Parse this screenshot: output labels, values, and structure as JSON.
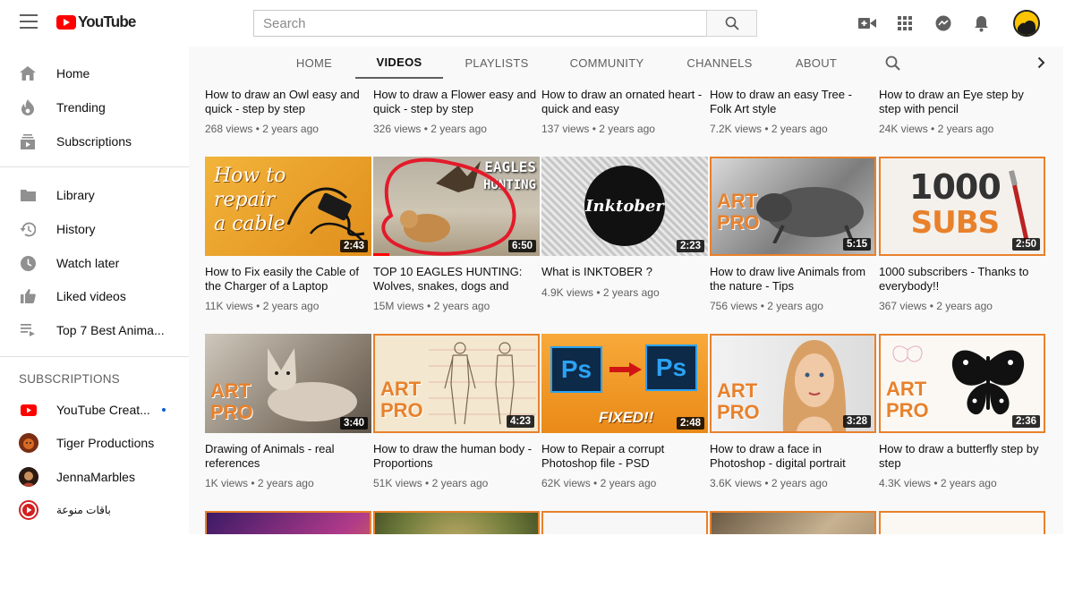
{
  "header": {
    "logo_text": "YouTube",
    "search_placeholder": "Search"
  },
  "sidebar": {
    "main_items": [
      {
        "label": "Home",
        "icon": "home-icon"
      },
      {
        "label": "Trending",
        "icon": "flame-icon"
      },
      {
        "label": "Subscriptions",
        "icon": "subscriptions-icon"
      }
    ],
    "library_items": [
      {
        "label": "Library",
        "icon": "folder-icon"
      },
      {
        "label": "History",
        "icon": "history-icon"
      },
      {
        "label": "Watch later",
        "icon": "clock-icon"
      },
      {
        "label": "Liked videos",
        "icon": "thumbs-up-icon"
      },
      {
        "label": "Top 7 Best Anima...",
        "icon": "playlist-icon"
      }
    ],
    "subscriptions_header": "SUBSCRIPTIONS",
    "subscriptions": [
      {
        "label": "YouTube Creat...",
        "new": true
      },
      {
        "label": "Tiger Productions"
      },
      {
        "label": "JennaMarbles"
      },
      {
        "label": "باقات منوعة"
      }
    ]
  },
  "tabs": [
    "HOME",
    "VIDEOS",
    "PLAYLISTS",
    "COMMUNITY",
    "CHANNELS",
    "ABOUT"
  ],
  "active_tab": "VIDEOS",
  "videos": [
    {
      "title": "How to draw an Owl easy and quick - step by step",
      "views": "268 views",
      "age": "2 years ago"
    },
    {
      "title": "How to draw a Flower easy and quick - step by step",
      "views": "326 views",
      "age": "2 years ago"
    },
    {
      "title": "How to draw an ornated heart - quick and easy",
      "views": "137 views",
      "age": "2 years ago"
    },
    {
      "title": "How to draw an easy Tree - Folk Art style",
      "views": "7.2K views",
      "age": "2 years ago"
    },
    {
      "title": "How to draw an Eye step by step with pencil",
      "views": "24K views",
      "age": "2 years ago"
    },
    {
      "title": "How to Fix easily the Cable of the Charger of a Laptop",
      "views": "11K views",
      "age": "2 years ago",
      "duration": "2:43",
      "thumb_text": [
        "How to",
        "repair",
        "a cable"
      ]
    },
    {
      "title": "TOP 10 EAGLES HUNTING: Wolves, snakes, dogs and",
      "views": "15M views",
      "age": "2 years ago",
      "duration": "6:50",
      "thumb_text": [
        "EAGLES",
        "HUNTING"
      ]
    },
    {
      "title": "What is INKTOBER ?",
      "views": "4.9K views",
      "age": "2 years ago",
      "duration": "2:23",
      "thumb_text": [
        "Inktober"
      ]
    },
    {
      "title": "How to draw live Animals from the nature - Tips",
      "views": "756 views",
      "age": "2 years ago",
      "duration": "5:15",
      "thumb_text": [
        "ART",
        "PRO"
      ]
    },
    {
      "title": "1000 subscribers - Thanks to everybody!!",
      "views": "367 views",
      "age": "2 years ago",
      "duration": "2:50",
      "thumb_text": [
        "1000",
        "SUBS"
      ]
    },
    {
      "title": "Drawing of Animals - real references",
      "views": "1K views",
      "age": "2 years ago",
      "duration": "3:40",
      "thumb_text": [
        "ART",
        "PRO"
      ]
    },
    {
      "title": "How to draw the human body - Proportions",
      "views": "51K views",
      "age": "2 years ago",
      "duration": "4:23",
      "thumb_text": [
        "ART",
        "PRO"
      ]
    },
    {
      "title": "How to Repair a corrupt Photoshop file - PSD",
      "views": "62K views",
      "age": "2 years ago",
      "duration": "2:48",
      "thumb_text": [
        "Ps",
        "Ps",
        "FIXED!!"
      ]
    },
    {
      "title": "How to draw a face in Photoshop - digital portrait",
      "views": "3.6K views",
      "age": "2 years ago",
      "duration": "3:28",
      "thumb_text": [
        "ART",
        "PRO"
      ]
    },
    {
      "title": "How to draw a butterfly step by step",
      "views": "4.3K views",
      "age": "2 years ago",
      "duration": "2:36",
      "thumb_text": [
        "ART",
        "PRO"
      ]
    }
  ],
  "colors": {
    "brand_red": "#ff0000",
    "thumb_frame_orange": "#e8812c",
    "annotation_red": "#e21b2b"
  }
}
